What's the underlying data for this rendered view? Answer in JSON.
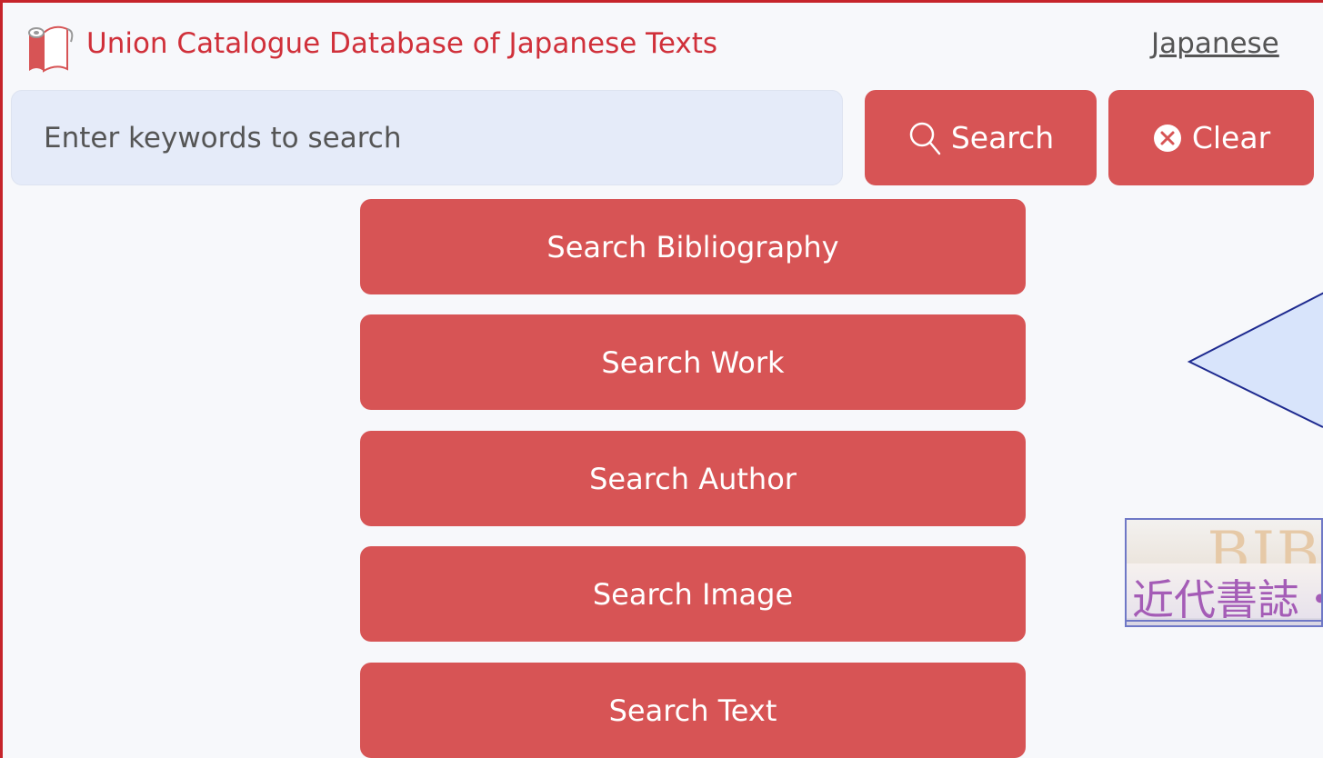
{
  "header": {
    "site_title": "Union Catalogue Database of Japanese Texts",
    "language_link": "Japanese"
  },
  "search": {
    "placeholder": "Enter keywords to search",
    "value": "",
    "search_button": "Search",
    "clear_button": "Clear"
  },
  "menu": [
    {
      "label": "Search Bibliography"
    },
    {
      "label": "Search Work"
    },
    {
      "label": "Search Author"
    },
    {
      "label": "Search Image"
    },
    {
      "label": "Search Text"
    }
  ],
  "banner": {
    "text": "近代書誌・近",
    "background_text": "BIB"
  },
  "icons": {
    "logo": "book-scroll-icon",
    "search": "magnifier-icon",
    "clear": "circle-x-icon"
  },
  "colors": {
    "brand": "#d0303a",
    "button": "#d75455",
    "input_bg": "#e5ebf9",
    "tooltip_fill": "#d8e4fb",
    "frame": "#c6242b"
  }
}
